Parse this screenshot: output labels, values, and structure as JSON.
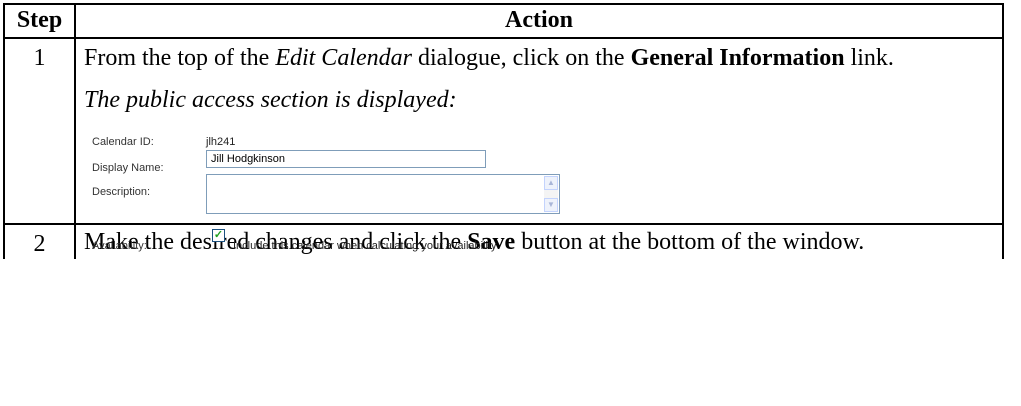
{
  "table": {
    "header_step": "Step",
    "header_action": "Action"
  },
  "step1": {
    "number": "1",
    "line_before_em": "From the top of the ",
    "em_text": "Edit Calendar",
    "line_after_em": " dialogue, click on the ",
    "bold_link": "General Information",
    "line_end": " link.",
    "caption": "The public access section is displayed:"
  },
  "panel": {
    "calendar_id_label": "Calendar ID:",
    "calendar_id_value": "jlh241",
    "display_name_label": "Display Name:",
    "display_name_value": "Jill Hodgkinson",
    "description_label": "Description:",
    "description_value": "",
    "availability_label": "Availability:",
    "availability_checked": true,
    "availability_option": "Include this calendar when calculating your availability",
    "scroll_up_glyph": "▲",
    "scroll_down_glyph": "▼",
    "check_glyph": "✓",
    "checkbox_color": "#21a121"
  },
  "step2": {
    "number": "2",
    "text_before_bold": "Make the desired changes and click the ",
    "bold_text": "Save",
    "text_after_bold": " button at the bottom of the window."
  }
}
